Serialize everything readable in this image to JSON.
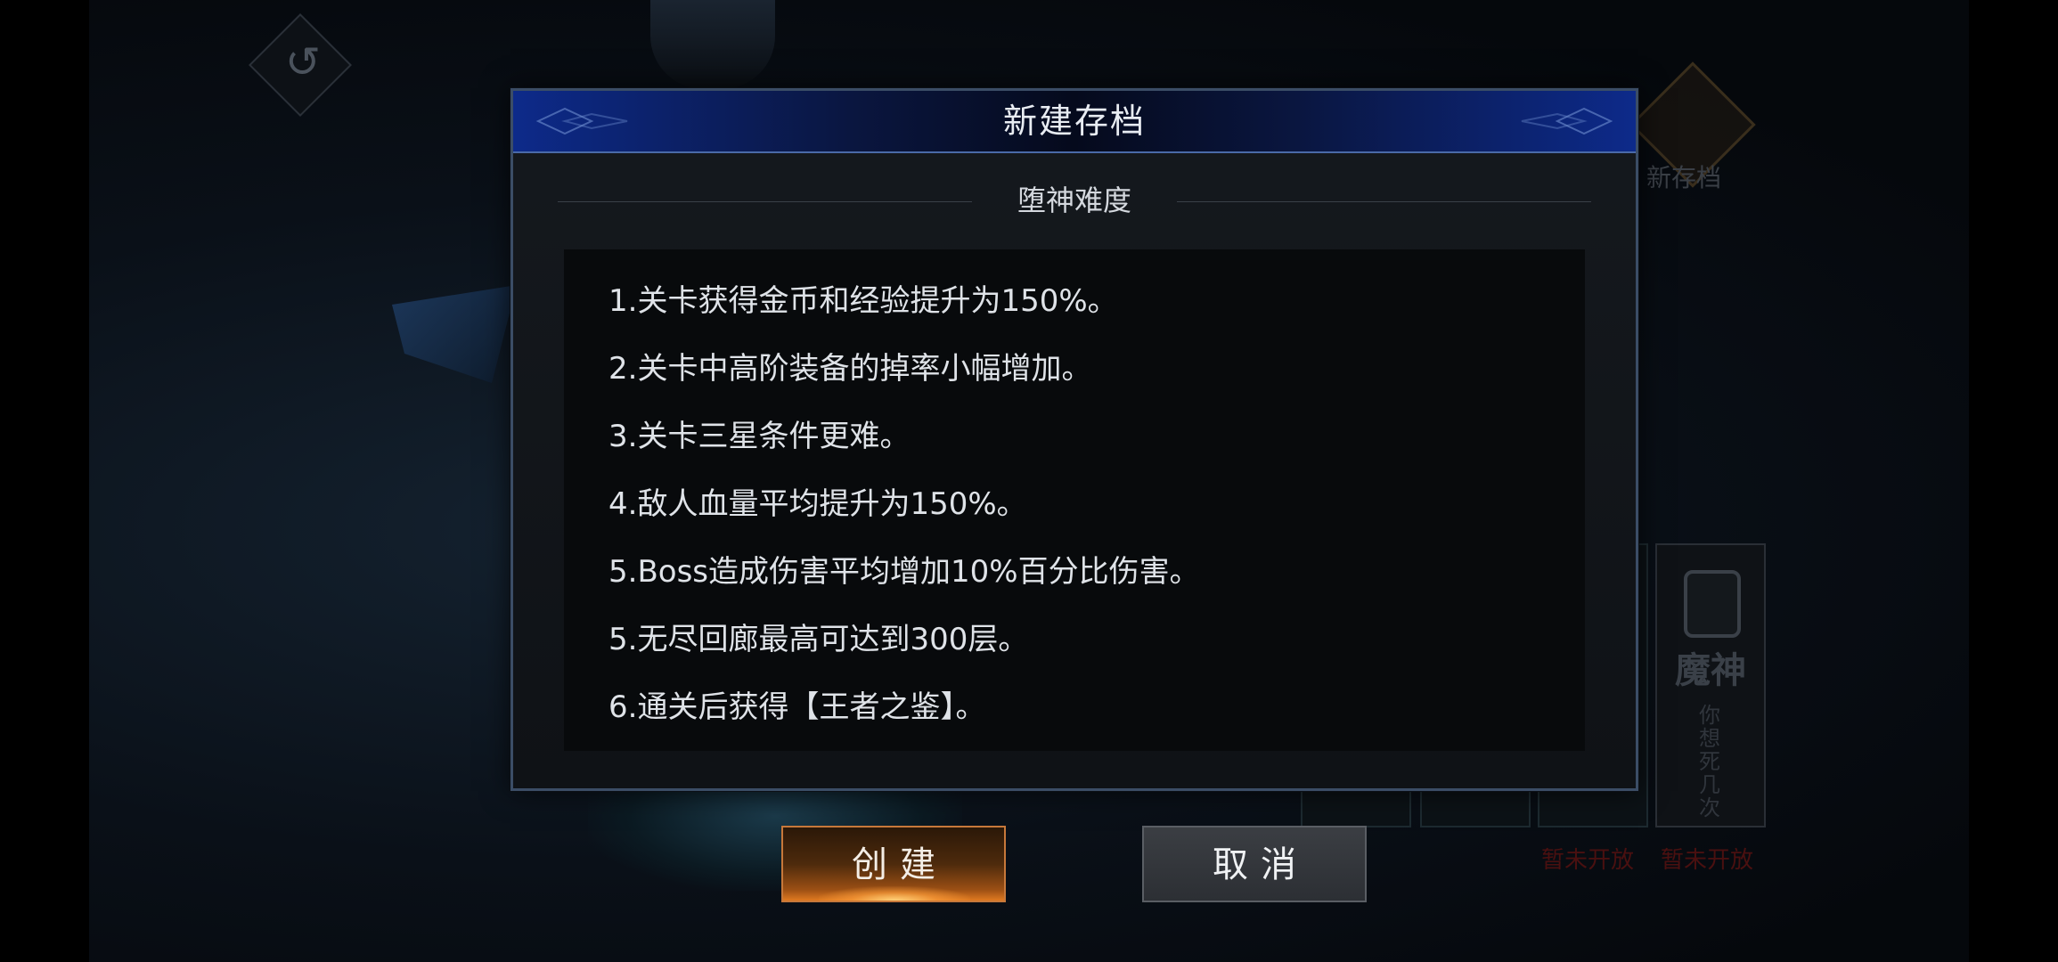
{
  "dialog": {
    "title": "新建存档",
    "subtitle": "堕神难度",
    "rules": [
      "1.关卡获得金币和经验提升为150%。",
      "2.关卡中高阶装备的掉率小幅增加。",
      "3.关卡三星条件更难。",
      "4.敌人血量平均提升为150%。",
      "5.Boss造成伤害平均增加10%百分比伤害。",
      "5.无尽回廊最高可达到300层。",
      "6.通关后获得【王者之鉴】。"
    ],
    "create_label": "创建",
    "cancel_label": "取消"
  },
  "background": {
    "new_save_label": "新存档",
    "locked_card_title": "魔神",
    "locked_card_subtitle": "你想死几次",
    "status_left": "暂未开放",
    "status_right": "暂未开放"
  },
  "colors": {
    "header_blue": "#0d2a8a",
    "create_orange": "#e07a20",
    "cancel_gray": "#3b3e43"
  }
}
